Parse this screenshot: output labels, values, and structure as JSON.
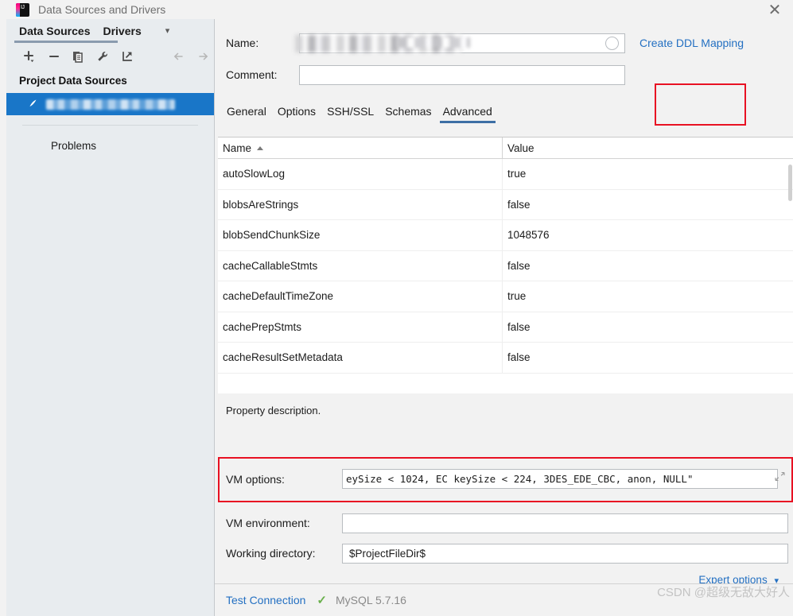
{
  "window": {
    "title": "Data Sources and Drivers",
    "app_icon": "intellij-icon",
    "close_label": "✕"
  },
  "sidebar": {
    "tabs": [
      {
        "label": "Data Sources",
        "active": true
      },
      {
        "label": "Drivers",
        "active": false
      }
    ],
    "tabs_overflow_icon": "chevron-down-icon",
    "toolbar": [
      {
        "name": "add-button",
        "icon": "plus-icon"
      },
      {
        "name": "remove-button",
        "icon": "minus-icon"
      },
      {
        "name": "duplicate-button",
        "icon": "copy-icon"
      },
      {
        "name": "properties-button",
        "icon": "wrench-icon"
      },
      {
        "name": "jump-to-button",
        "icon": "external-link-icon"
      },
      {
        "name": "back-button",
        "icon": "arrow-left-icon"
      },
      {
        "name": "forward-button",
        "icon": "arrow-right-icon"
      }
    ],
    "group_title": "Project Data Sources",
    "selected_data_source": {
      "icon": "mysql-dolphin-icon",
      "name_redacted": true
    },
    "problems_label": "Problems"
  },
  "details": {
    "name_label": "Name:",
    "name_value": "",
    "name_redacted": true,
    "name_trailing_icon": "circle-icon",
    "create_ddl_mapping_label": "Create DDL Mapping",
    "comment_label": "Comment:",
    "comment_value": "",
    "comment_expand_icon": "expand-icon",
    "tabs": [
      {
        "label": "General",
        "active": false
      },
      {
        "label": "Options",
        "active": false
      },
      {
        "label": "SSH/SSL",
        "active": false
      },
      {
        "label": "Schemas",
        "active": false
      },
      {
        "label": "Advanced",
        "active": true
      }
    ],
    "highlight_color": "#e81123",
    "active_tab_underline_color": "#3d6fa5"
  },
  "properties_table": {
    "columns": [
      "Name",
      "Value"
    ],
    "sort_column": "Name",
    "sort_direction": "asc",
    "rows": [
      {
        "name": "autoSlowLog",
        "value": "true"
      },
      {
        "name": "blobsAreStrings",
        "value": "false"
      },
      {
        "name": "blobSendChunkSize",
        "value": "1048576"
      },
      {
        "name": "cacheCallableStmts",
        "value": "false"
      },
      {
        "name": "cacheDefaultTimeZone",
        "value": "true"
      },
      {
        "name": "cachePrepStmts",
        "value": "false"
      },
      {
        "name": "cacheResultSetMetadata",
        "value": "false"
      }
    ]
  },
  "description": {
    "text": "Property description."
  },
  "vm_section": {
    "options_label": "VM options:",
    "options_value": "eySize < 1024, EC keySize < 224, 3DES_EDE_CBC, anon, NULL\"",
    "options_expand_icon": "expand-icon",
    "environment_label": "VM environment:",
    "environment_value": "",
    "environment_icon": "list-icon",
    "working_directory_label": "Working directory:",
    "working_directory_value": "$ProjectFileDir$",
    "working_directory_icons": [
      "list-icon",
      "folder-icon"
    ],
    "expert_options_label": "Expert options",
    "expert_options_chevron": "chevron-down-icon"
  },
  "status_bar": {
    "test_connection_label": "Test Connection",
    "status_icon": "check-icon",
    "status_color": "#6ab04c",
    "db_version": "MySQL 5.7.16"
  },
  "watermark": {
    "text": "CSDN @超级无敌大好人"
  }
}
